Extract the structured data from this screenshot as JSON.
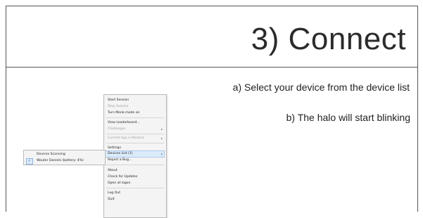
{
  "slide": {
    "title": "3) Connect",
    "bullet_a": "a) Select your device from the device list",
    "bullet_b": "b) The halo will start blinking"
  },
  "menu": {
    "items": [
      {
        "label": "Start Session",
        "disabled": false
      },
      {
        "label": "Stop Session",
        "disabled": true
      },
      {
        "label": "Turn Monk-mode on",
        "disabled": false
      },
      {
        "label": "View Leaderboard...",
        "disabled": false
      },
      {
        "label": "Challenges",
        "disabled": true,
        "submenu": true
      },
      {
        "label": "Current App is Neutral",
        "disabled": true,
        "submenu": true
      },
      {
        "label": "Settings",
        "disabled": false
      },
      {
        "label": "Devices List (1)",
        "disabled": false,
        "submenu": true,
        "highlighted": true
      },
      {
        "label": "Report a Bug...",
        "disabled": false
      },
      {
        "label": "About",
        "disabled": false
      },
      {
        "label": "Check for Updates",
        "disabled": false
      },
      {
        "label": "Open at logon",
        "disabled": false
      },
      {
        "label": "Log Out",
        "disabled": false
      },
      {
        "label": "Quit",
        "disabled": false
      }
    ],
    "arrow_glyph": "▸"
  },
  "submenu": {
    "status": "Devices Scanning",
    "device": "Wouter Daniels (battery: 4%)",
    "check_glyph": "✓"
  },
  "colors": {
    "highlight": "#dcebfb",
    "menu_bg": "#f4f4f4"
  }
}
